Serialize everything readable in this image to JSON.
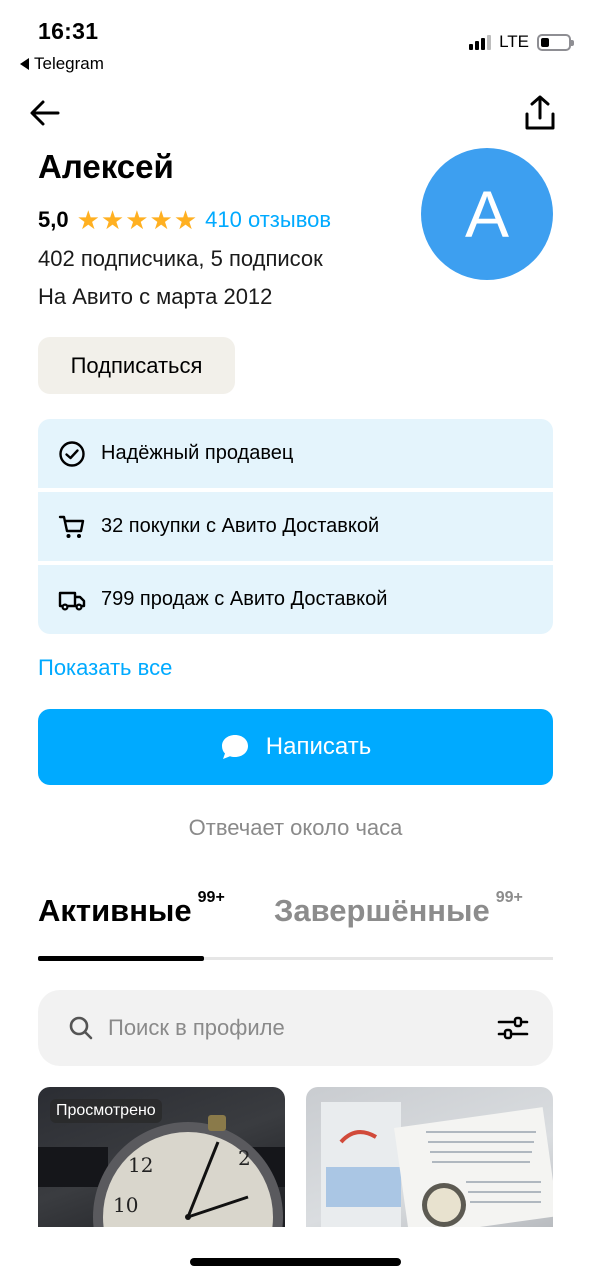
{
  "status_bar": {
    "time": "16:31",
    "back_app": "Telegram",
    "network": "LTE",
    "signal_bars": 3,
    "battery_level": 0.2
  },
  "nav": {
    "back_icon": "arrow-left-icon",
    "share_icon": "share-icon"
  },
  "profile": {
    "name": "Алексей",
    "rating": "5,0",
    "stars": 5,
    "reviews": "410 отзывов",
    "subscribers": "402 подписчика, 5 подписок",
    "since": "На Авито с марта 2012",
    "avatar_letter": "А",
    "avatar_color": "#3d9ff0",
    "subscribe_label": "Подписаться"
  },
  "badges": [
    {
      "icon": "check-circle-icon",
      "text": "Надёжный продавец"
    },
    {
      "icon": "cart-icon",
      "text": "32 покупки с Авито Доставкой"
    },
    {
      "icon": "truck-icon",
      "text": "799 продаж с Авито Доставкой"
    }
  ],
  "show_all": "Показать все",
  "write_button": {
    "label": "Написать",
    "icon": "chat-bubble-icon"
  },
  "responds": "Отвечает около часа",
  "tabs": [
    {
      "label": "Активные",
      "count": "99+",
      "active": true
    },
    {
      "label": "Завершённые",
      "count": "99+",
      "active": false
    }
  ],
  "search": {
    "placeholder": "Поиск в профиле",
    "value": ""
  },
  "listings": [
    {
      "badge": "Просмотрено"
    },
    {
      "badge": ""
    }
  ],
  "colors": {
    "accent": "#00aaff",
    "star": "#ffb021",
    "badge_bg": "#e4f4fc",
    "subscribe_bg": "#f2f0ea"
  }
}
